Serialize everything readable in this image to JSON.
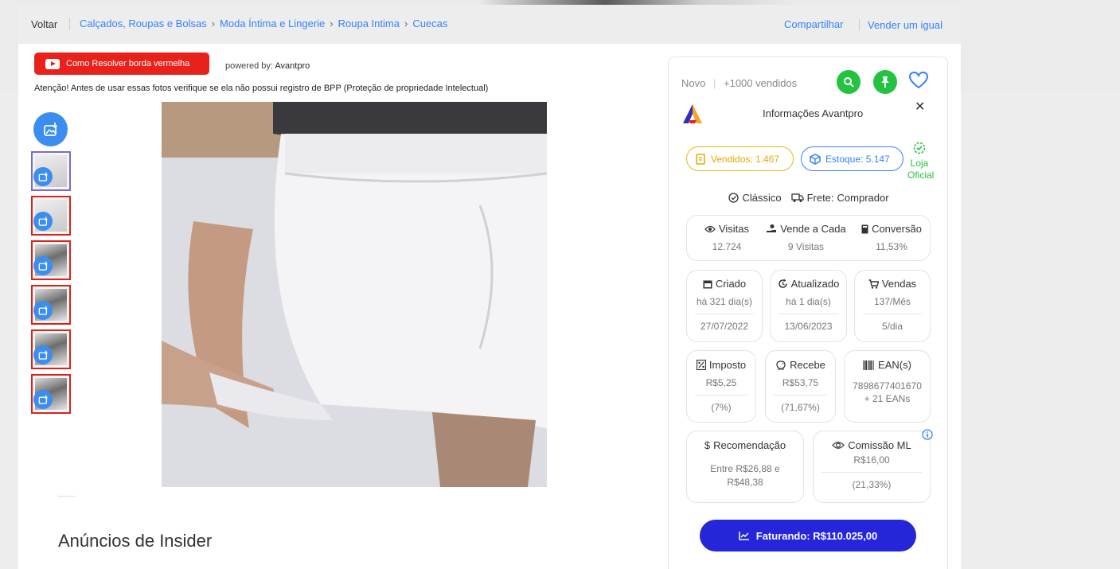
{
  "breadcrumb": {
    "back_label": "Voltar",
    "items": [
      "Calçados, Roupas e Bolsas",
      "Moda Íntima e Lingerie",
      "Roupa Intima",
      "Cuecas"
    ],
    "share_label": "Compartilhar",
    "sell_same_label": "Vender um igual"
  },
  "extension": {
    "youtube_button_label": "Como Resolver borda vermelha",
    "powered_by_label": "powered by:",
    "powered_by_brand": "Avantpro",
    "warning_text": "Atenção! Antes de usar essas fotos verifique se ela não possui registro de BPP (Proteção de propriedade Intelectual)"
  },
  "section": {
    "insider_title": "Anúncios de Insider"
  },
  "panel": {
    "condition": "Novo",
    "sold_count": "+1000 vendidos",
    "info_title": "Informações Avantpro",
    "close_symbol": "✕",
    "sold_pill": "Vendidos: 1.467",
    "stock_pill": "Estoque: 5.147",
    "official_store": "Loja Oficial",
    "listing_type": "Clássico",
    "shipping_label": "Frete:",
    "shipping_value": "Comprador",
    "stats": {
      "visits_label": "Visitas",
      "visits_value": "12.724",
      "sells_every_label": "Vende a Cada",
      "sells_every_value": "9 Visitas",
      "conversion_label": "Conversão",
      "conversion_value": "11,53%"
    },
    "created": {
      "label": "Criado",
      "ago": "há 321 dia(s)",
      "date": "27/07/2022"
    },
    "updated": {
      "label": "Atualizado",
      "ago": "há 1 dia(s)",
      "date": "13/06/2023"
    },
    "sales": {
      "label": "Vendas",
      "per_month": "137/Mês",
      "per_day": "5/dia"
    },
    "tax": {
      "label": "Imposto",
      "value": "R$5,25",
      "percent": "(7%)"
    },
    "receive": {
      "label": "Recebe",
      "value": "R$53,75",
      "percent": "(71,67%)"
    },
    "ean": {
      "label": "EAN(s)",
      "code": "7898677401670",
      "extra": "+ 21 EANs"
    },
    "recommendation": {
      "label": "Recomendação",
      "value": "Entre R$26,88 e R$48,38"
    },
    "commission": {
      "label": "Comissão ML",
      "value": "R$16,00",
      "percent": "(21,33%)"
    },
    "revenue_button": "Faturando: R$110.025,00"
  },
  "colors": {
    "link_blue": "#3483fa",
    "youtube_red": "#e8221b",
    "green": "#23c341",
    "gold": "#e5b817",
    "cta_blue": "#2525d9",
    "thumb_border_red": "#d6241d"
  },
  "icons": [
    "youtube-icon",
    "download-image-icon",
    "search-icon",
    "pin-icon",
    "heart-icon",
    "avantpro-logo-icon",
    "close-icon",
    "receipt-icon",
    "box-icon",
    "verified-check-icon",
    "check-circle-icon",
    "truck-icon",
    "eye-icon",
    "hand-money-icon",
    "calculator-icon",
    "calendar-icon",
    "refresh-clock-icon",
    "cart-icon",
    "tax-icon",
    "piggy-bank-icon",
    "barcode-icon",
    "dollar-icon",
    "commission-eye-icon",
    "info-icon",
    "chart-trend-icon"
  ]
}
